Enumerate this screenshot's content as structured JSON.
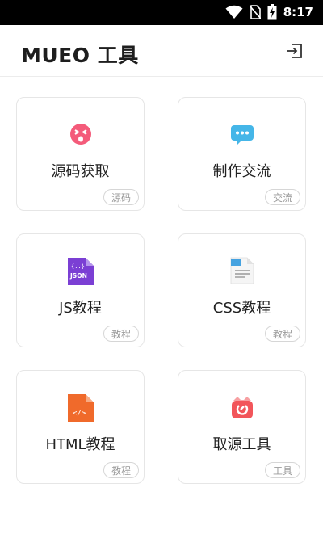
{
  "status_bar": {
    "time": "8:17"
  },
  "app_bar": {
    "title": "MUEO 工具"
  },
  "cards": [
    {
      "label": "源码获取",
      "tag": "源码",
      "icon": "shocked-face-icon"
    },
    {
      "label": "制作交流",
      "tag": "交流",
      "icon": "chat-bubble-icon"
    },
    {
      "label": "JS教程",
      "tag": "教程",
      "icon": "json-file-icon"
    },
    {
      "label": "CSS教程",
      "tag": "教程",
      "icon": "css-file-icon"
    },
    {
      "label": "HTML教程",
      "tag": "教程",
      "icon": "html-file-icon"
    },
    {
      "label": "取源工具",
      "tag": "工具",
      "icon": "source-tool-icon"
    }
  ],
  "colors": {
    "status_bar": "#000000",
    "pink": "#f45b7a",
    "blue": "#45b6e8",
    "purple": "#7b3fd4",
    "orange": "#f06a2b",
    "red": "#f2555a"
  }
}
